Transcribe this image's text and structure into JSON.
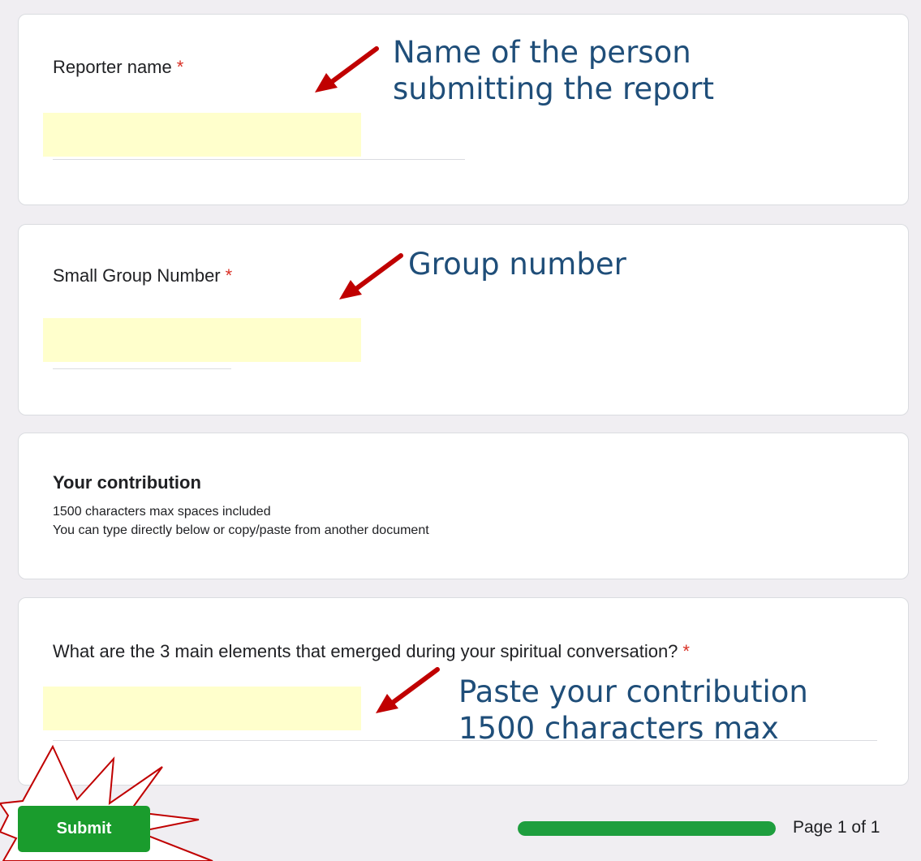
{
  "form": {
    "reporter_name": {
      "label": "Reporter name",
      "required_mark": "*",
      "value": ""
    },
    "group_number": {
      "label": "Small Group Number",
      "required_mark": "*",
      "value": ""
    },
    "contribution_section": {
      "title": "Your contribution",
      "description_line1": "1500 characters max spaces included",
      "description_line2": "You can type directly below or copy/paste from another document"
    },
    "main_elements": {
      "label": "What are the 3 main elements that emerged during your spiritual conversation?",
      "required_mark": "*",
      "value": ""
    }
  },
  "annotations": {
    "reporter_line1": "Name of the person",
    "reporter_line2": "submitting the report",
    "group": "Group number",
    "contribution_line1": "Paste your contribution",
    "contribution_line2": "1500 characters max"
  },
  "footer": {
    "submit_label": "Submit",
    "page_indicator": "Page 1 of 1",
    "progress_percent": 100
  },
  "colors": {
    "annotation_text": "#1f4e79",
    "arrow": "#c00000",
    "input_highlight": "#ffffcc",
    "submit_button": "#1a9c2d",
    "progress_fill": "#1e9e3e",
    "required": "#d93025"
  },
  "icons": {
    "arrow": "red-arrow-icon",
    "burst": "starburst-icon"
  }
}
